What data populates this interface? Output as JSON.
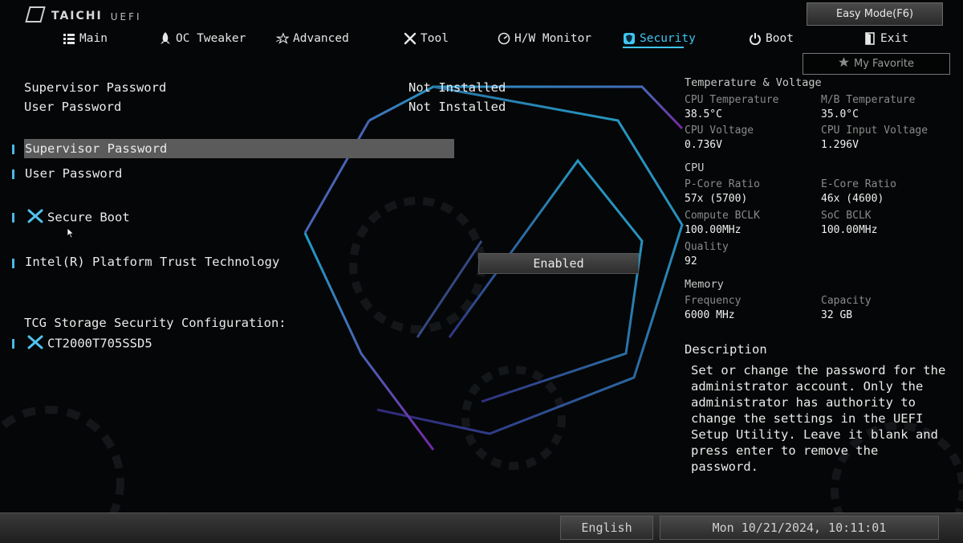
{
  "header": {
    "logo_brand": "TAICHI",
    "logo_sub": "UEFI",
    "easy_mode": "Easy Mode(F6)",
    "my_favorite": "My Favorite"
  },
  "nav": [
    {
      "label": "Main",
      "icon": "list-icon"
    },
    {
      "label": "OC Tweaker",
      "icon": "rocket-icon"
    },
    {
      "label": "Advanced",
      "icon": "star-icon"
    },
    {
      "label": "Tool",
      "icon": "wrench-icon"
    },
    {
      "label": "H/W Monitor",
      "icon": "gauge-icon"
    },
    {
      "label": "Security",
      "icon": "shield-icon",
      "active": true
    },
    {
      "label": "Boot",
      "icon": "power-icon"
    },
    {
      "label": "Exit",
      "icon": "exit-door-icon"
    }
  ],
  "status": {
    "supervisor_label": "Supervisor Password",
    "supervisor_value": "Not Installed",
    "user_label": "User Password",
    "user_value": "Not Installed"
  },
  "menu": {
    "supervisor_password": "Supervisor Password",
    "user_password": "User Password",
    "secure_boot": "Secure Boot",
    "ptt_label": "Intel(R) Platform Trust Technology",
    "ptt_value": "Enabled",
    "tcg_heading": "TCG Storage Security Configuration:",
    "tcg_device": "CT2000T705SSD5"
  },
  "monitor": {
    "temp_voltage_title": "Temperature & Voltage",
    "cpu_temp_label": "CPU Temperature",
    "cpu_temp_value": "38.5°C",
    "mb_temp_label": "M/B Temperature",
    "mb_temp_value": "35.0°C",
    "cpu_voltage_label": "CPU Voltage",
    "cpu_voltage_value": "0.736V",
    "cpu_input_voltage_label": "CPU Input Voltage",
    "cpu_input_voltage_value": "1.296V",
    "cpu_title": "CPU",
    "pcore_label": "P-Core Ratio",
    "pcore_value": "57x (5700)",
    "ecore_label": "E-Core Ratio",
    "ecore_value": "46x (4600)",
    "compute_bclk_label": "Compute BCLK",
    "compute_bclk_value": "100.00MHz",
    "soc_bclk_label": "SoC BCLK",
    "soc_bclk_value": "100.00MHz",
    "quality_label": "Quality",
    "quality_value": "92",
    "memory_title": "Memory",
    "freq_label": "Frequency",
    "freq_value": "6000 MHz",
    "capacity_label": "Capacity",
    "capacity_value": "32 GB"
  },
  "description": {
    "title": "Description",
    "text": "Set or change the password for the administrator account. Only the administrator has authority to change the settings in the UEFI Setup Utility. Leave it blank and press enter to remove the password."
  },
  "footer": {
    "language": "English",
    "datetime": "Mon 10/21/2024, 10:11:01"
  },
  "colors": {
    "accent": "#3ec6f2",
    "highlight": "#5b5b5b",
    "background": "#050607"
  }
}
